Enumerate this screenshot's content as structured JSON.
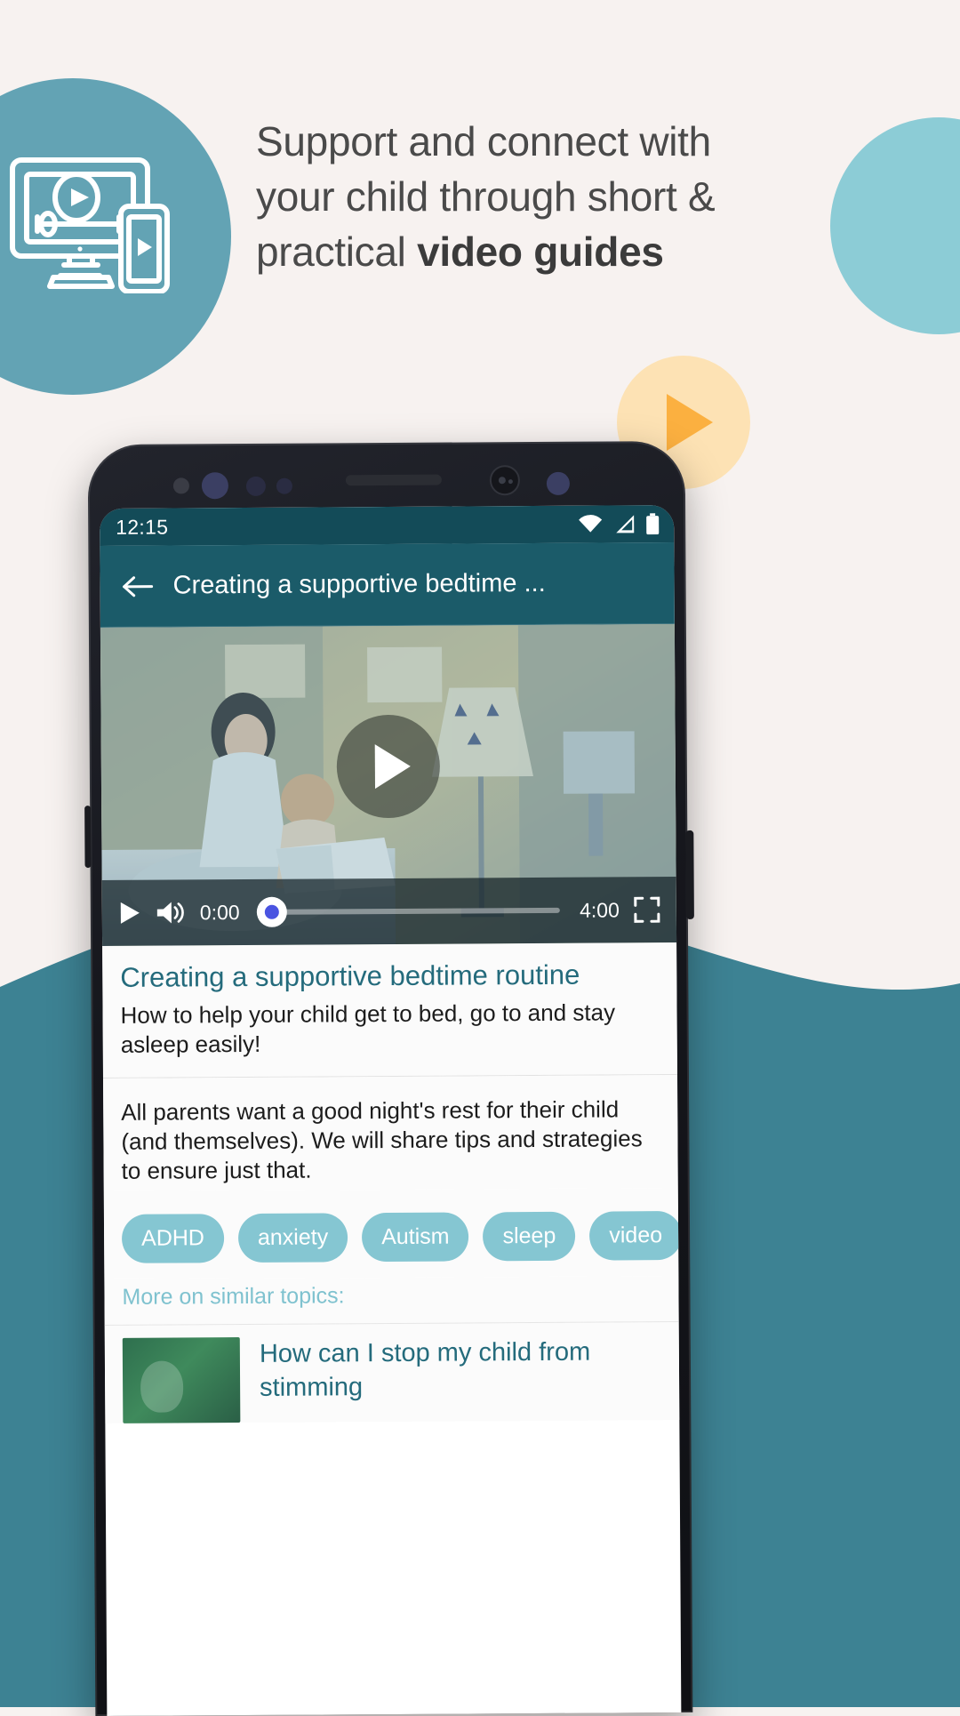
{
  "promo": {
    "headline_parts": {
      "normal": "Support and connect with your child through short & practical ",
      "bold": "video guides"
    },
    "icon_left": "video-devices-icon",
    "play_badge_icon": "play-triangle-icon",
    "colors": {
      "background": "#f7f2f0",
      "teal_circle": "#63a3b4",
      "light_teal_circle": "#8cccd6",
      "peach_circle": "#fde2b4",
      "orange_play": "#fbb040",
      "bottom_wave": "#3d8293",
      "headline_text": "#4a4a4a"
    }
  },
  "phone": {
    "statusbar": {
      "time": "12:15",
      "icons": [
        "wifi-icon",
        "signal-icon",
        "battery-icon"
      ],
      "background": "#134b58"
    },
    "appbar": {
      "back_icon": "back-arrow-icon",
      "title": "Creating a supportive bedtime ...",
      "background": "#1b5b69"
    },
    "video": {
      "overlay_play_icon": "play-circle-icon",
      "controls": {
        "play_icon": "play-icon",
        "volume_icon": "volume-icon",
        "current_time": "0:00",
        "duration": "4:00",
        "fullscreen_icon": "fullscreen-icon",
        "progress_percent": 0,
        "knob_color": "#4a54e1"
      }
    },
    "article": {
      "title": "Creating a supportive bedtime routine",
      "subtitle": "How to help your child get to bed, go to and stay asleep easily!",
      "body": "All parents want a good night's rest for their child (and themselves). We will share tips and strategies to ensure just that.",
      "title_color": "#246b7c"
    },
    "tags": [
      {
        "label": "ADHD"
      },
      {
        "label": "anxiety"
      },
      {
        "label": "Autism"
      },
      {
        "label": "sleep"
      },
      {
        "label": "video"
      }
    ],
    "more_topics_label": "More on similar topics:",
    "related": [
      {
        "title": "How can I stop my child from stimming",
        "thumb": "related-thumbnail"
      }
    ]
  }
}
